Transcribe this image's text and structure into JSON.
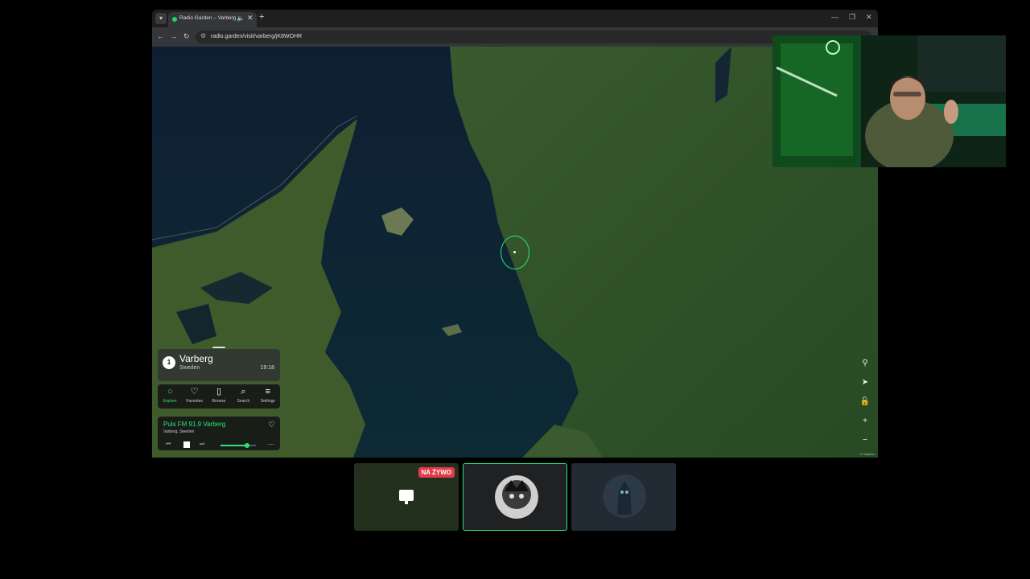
{
  "browser": {
    "tab_title": "Radio Garden – Varberg",
    "url": "radio.garden/visit/varberg/jK8WOHR"
  },
  "place": {
    "count": "1",
    "name": "Varberg",
    "country": "Sweden",
    "time": "19:18"
  },
  "nav": {
    "items": [
      {
        "label": "Explore",
        "icon": "explore-icon",
        "active": true
      },
      {
        "label": "Favorites",
        "icon": "heart-icon",
        "active": false
      },
      {
        "label": "Browse",
        "icon": "map-icon",
        "active": false
      },
      {
        "label": "Search",
        "icon": "search-icon",
        "active": false
      },
      {
        "label": "Settings",
        "icon": "menu-icon",
        "active": false
      }
    ]
  },
  "player": {
    "station": "Puls FM 91.9 Varberg",
    "location": "Varberg, Sweden",
    "volume": 0.75
  },
  "stream": {
    "live_badge": "NA ŻYWO"
  },
  "colors": {
    "accent": "#2ee37a",
    "live": "#e13b49"
  }
}
